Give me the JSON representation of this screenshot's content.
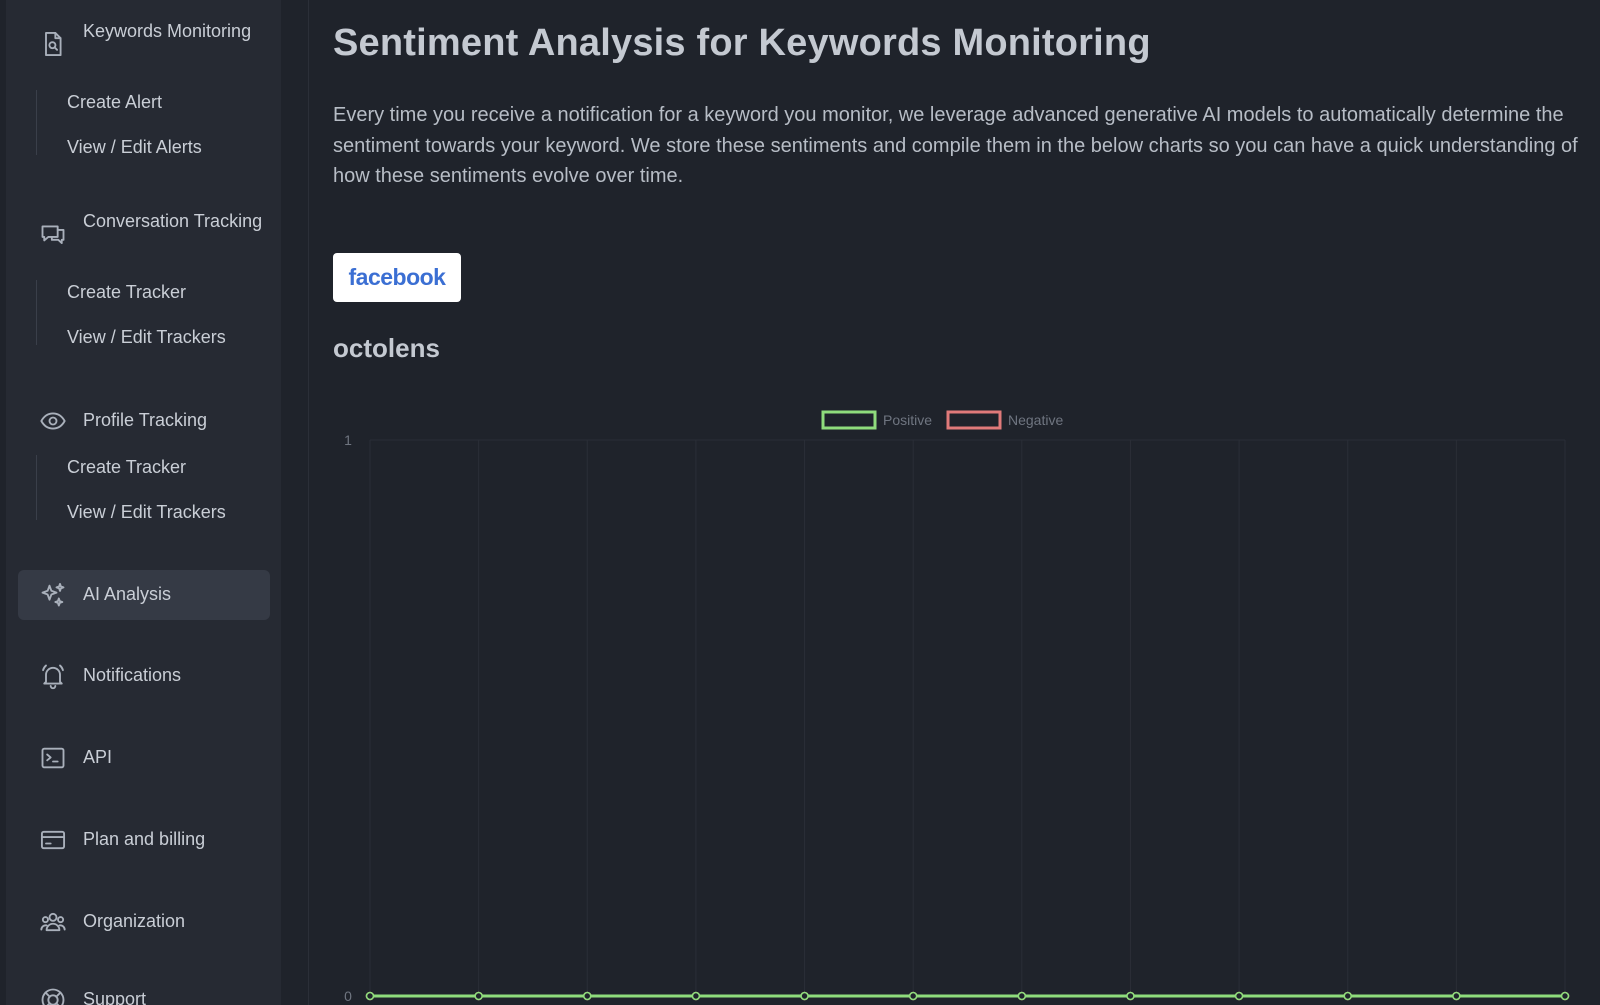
{
  "sidebar": {
    "sections": [
      {
        "label": "Keywords Monitoring",
        "icon": "file-search-icon",
        "sub_items": [
          "Create Alert",
          "View / Edit Alerts"
        ]
      },
      {
        "label": "Conversation Tracking",
        "icon": "chat-bubbles-icon",
        "sub_items": [
          "Create Tracker",
          "View / Edit Trackers"
        ]
      },
      {
        "label": "Profile Tracking",
        "icon": "eye-icon",
        "sub_items": [
          "Create Tracker",
          "View / Edit Trackers"
        ]
      }
    ],
    "items": [
      {
        "label": "AI Analysis",
        "icon": "sparkles-icon",
        "active": true
      },
      {
        "label": "Notifications",
        "icon": "bell-icon",
        "active": false
      },
      {
        "label": "API",
        "icon": "terminal-icon",
        "active": false
      },
      {
        "label": "Plan and billing",
        "icon": "credit-card-icon",
        "active": false
      },
      {
        "label": "Organization",
        "icon": "users-icon",
        "active": false
      },
      {
        "label": "Support",
        "icon": "lifebuoy-icon",
        "active": false
      }
    ]
  },
  "main": {
    "title": "Sentiment Analysis for Keywords Monitoring",
    "description": "Every time you receive a notification for a keyword you monitor, we leverage advanced generative AI models to automatically determine the sentiment towards your keyword. We store these sentiments and compile them in the below charts so you can have a quick understanding of how these sentiments evolve over time.",
    "platform": "facebook",
    "keyword": "octolens"
  },
  "colors": {
    "positive": "#8fdc7c",
    "negative": "#e07a7a",
    "accent_facebook": "#3b6fd3"
  },
  "chart_data": {
    "type": "line",
    "title": "",
    "xlabel": "",
    "ylabel": "",
    "ylim": [
      0,
      1
    ],
    "yticks": [
      "1",
      "0"
    ],
    "legend_position": "top-center",
    "grid": true,
    "series": [
      {
        "name": "Positive",
        "values": [
          0,
          0,
          0,
          0,
          0,
          0,
          0,
          0,
          0,
          0,
          0,
          0
        ]
      },
      {
        "name": "Negative",
        "values": [
          0,
          0,
          0,
          0,
          0,
          0,
          0,
          0,
          0,
          0,
          0,
          0
        ]
      }
    ]
  }
}
